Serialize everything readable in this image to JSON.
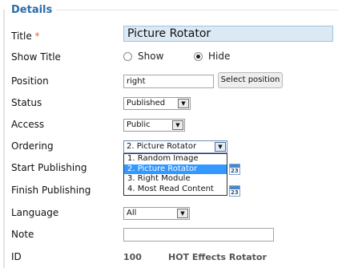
{
  "fieldset": {
    "legend": "Details"
  },
  "labels": {
    "title": "Title",
    "title_required": "*",
    "show_title": "Show Title",
    "position": "Position",
    "status": "Status",
    "access": "Access",
    "ordering": "Ordering",
    "start_publishing": "Start Publishing",
    "finish_publishing": "Finish Publishing",
    "language": "Language",
    "note": "Note",
    "id": "ID"
  },
  "fields": {
    "title_value": "Picture Rotator",
    "show_title": {
      "show_label": "Show",
      "hide_label": "Hide",
      "selected": "Hide"
    },
    "position_value": "right",
    "select_position_label": "Select position",
    "status_value": "Published",
    "access_value": "Public",
    "ordering_value": "2. Picture Rotator",
    "ordering_options": [
      "1. Random Image",
      "2. Picture Rotator",
      "3. Right Module",
      "4. Most Read Content"
    ],
    "ordering_selected_index": 1,
    "calendar_icon": "calendar-icon",
    "calendar_text": "23",
    "language_value": "All",
    "note_value": "",
    "id_value": "100",
    "module_type": "HOT Effects Rotator"
  }
}
